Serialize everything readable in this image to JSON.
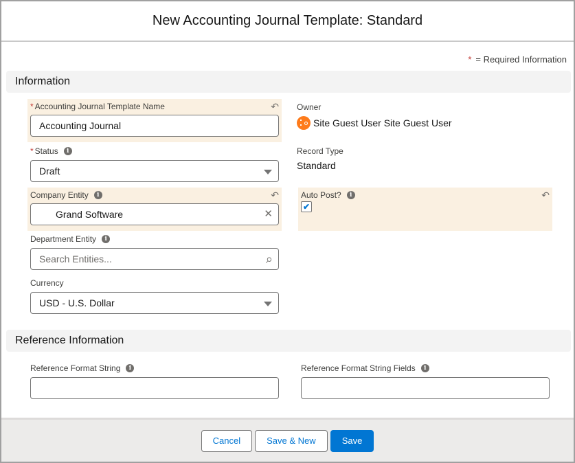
{
  "modal": {
    "title": "New Accounting Journal Template: Standard"
  },
  "required_note": {
    "star": "*",
    "text": "= Required Information"
  },
  "sections": {
    "information": {
      "title": "Information"
    },
    "reference": {
      "title": "Reference Information"
    }
  },
  "fields": {
    "template_name": {
      "label": "Accounting Journal Template Name",
      "required": true,
      "value": "Accounting Journal"
    },
    "status": {
      "label": "Status",
      "required": true,
      "value": "Draft"
    },
    "company_entity": {
      "label": "Company Entity",
      "value": "Grand Software"
    },
    "department_entity": {
      "label": "Department Entity",
      "placeholder": "Search Entities..."
    },
    "currency": {
      "label": "Currency",
      "value": "USD - U.S. Dollar"
    },
    "owner": {
      "label": "Owner",
      "value": "Site Guest User Site Guest User"
    },
    "record_type": {
      "label": "Record Type",
      "value": "Standard"
    },
    "auto_post": {
      "label": "Auto Post?",
      "checked": true
    },
    "reference_format_string": {
      "label": "Reference Format String",
      "value": ""
    },
    "reference_format_string_fields": {
      "label": "Reference Format String Fields",
      "value": ""
    }
  },
  "icons": {
    "undo": "↶",
    "info": "i",
    "clear": "✕",
    "search": "⌕",
    "check": "✔",
    "required_star": "*"
  },
  "footer": {
    "cancel_label": "Cancel",
    "save_new_label": "Save & New",
    "save_label": "Save"
  },
  "colors": {
    "brand": "#0176d3",
    "dirty_field_bg": "#faf0e1",
    "required": "#c23934",
    "avatar": "#fe7b1b"
  }
}
